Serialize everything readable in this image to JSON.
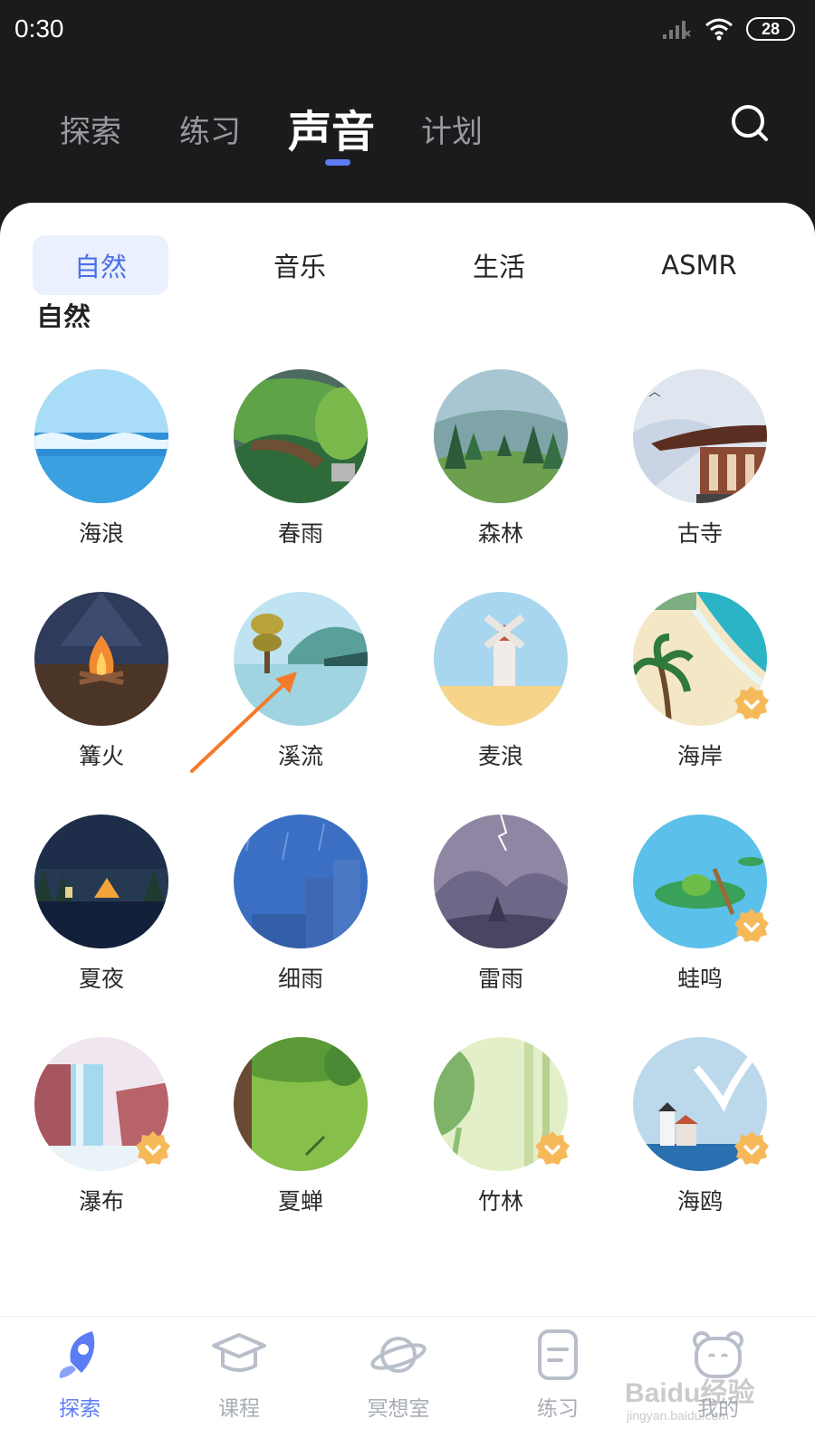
{
  "status_bar": {
    "time": "0:30",
    "battery": "28"
  },
  "top_nav": {
    "tabs": [
      {
        "label": "探索"
      },
      {
        "label": "练习"
      },
      {
        "label": "声音"
      },
      {
        "label": "计划"
      }
    ],
    "active_index": 2
  },
  "categories": {
    "tabs": [
      {
        "label": "自然"
      },
      {
        "label": "音乐"
      },
      {
        "label": "生活"
      },
      {
        "label": "ASMR"
      }
    ],
    "active_index": 0
  },
  "section_title": "自然",
  "sounds": [
    {
      "label": "海浪",
      "vip": false
    },
    {
      "label": "春雨",
      "vip": false
    },
    {
      "label": "森林",
      "vip": false
    },
    {
      "label": "古寺",
      "vip": false
    },
    {
      "label": "篝火",
      "vip": false
    },
    {
      "label": "溪流",
      "vip": false
    },
    {
      "label": "麦浪",
      "vip": false
    },
    {
      "label": "海岸",
      "vip": true
    },
    {
      "label": "夏夜",
      "vip": false
    },
    {
      "label": "细雨",
      "vip": false
    },
    {
      "label": "雷雨",
      "vip": false
    },
    {
      "label": "蛙鸣",
      "vip": true
    },
    {
      "label": "瀑布",
      "vip": true
    },
    {
      "label": "夏蝉",
      "vip": false
    },
    {
      "label": "竹林",
      "vip": true
    },
    {
      "label": "海鸥",
      "vip": true
    }
  ],
  "bottom_nav": {
    "items": [
      {
        "label": "探索",
        "icon": "rocket-icon"
      },
      {
        "label": "课程",
        "icon": "graduation-cap-icon"
      },
      {
        "label": "冥想室",
        "icon": "planet-icon"
      },
      {
        "label": "练习",
        "icon": "notes-icon"
      },
      {
        "label": "我的",
        "icon": "bear-profile-icon"
      }
    ],
    "active_index": 0
  },
  "watermark": {
    "text": "Baidu经验",
    "sub": "jingyan.baidu.com"
  },
  "colors": {
    "accent": "#5b7cf5",
    "category_active_bg": "#eaf0fd",
    "vip_badge": "#f6b95a",
    "annotation_arrow": "#f47a2a"
  }
}
